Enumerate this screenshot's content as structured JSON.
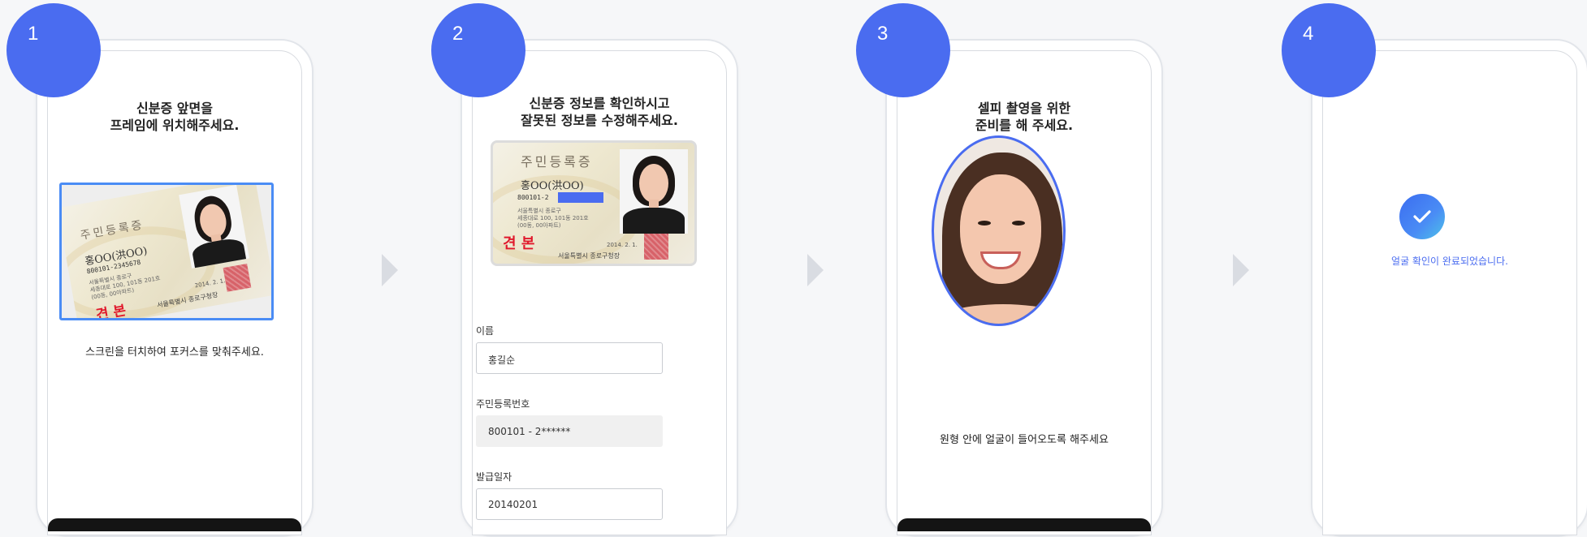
{
  "colors": {
    "accent": "#4a6cf0",
    "background": "#f6f7f9",
    "arrow": "#d9dce2",
    "card_sample_red": "#e0192c"
  },
  "steps": [
    {
      "number": "1",
      "title_line1": "신분증 앞면을",
      "title_line2": "프레임에 위치해주세요.",
      "hint": "스크린을 터치하여 포커스를 맞춰주세요.",
      "card": {
        "title": "주민등록증",
        "name": "홍OO(洪OO)",
        "number": "800101-2345678",
        "address_line1": "서울특별시 종로구",
        "address_line2": "세종대로 100, 101동 201호",
        "address_line3": "(00동, 00아파트)",
        "sample_mark": "견 본",
        "issue_date": "2014. 2. 1.",
        "authority": "서울특별시 종로구청장"
      }
    },
    {
      "number": "2",
      "title_line1": "신분증 정보를 확인하시고",
      "title_line2": "잘못된 정보를 수정해주세요.",
      "card": {
        "title": "주민등록증",
        "name": "홍OO(洪OO)",
        "number": "800101-2",
        "address_line1": "서울특별시 종로구",
        "address_line2": "세종대로 100, 101동 201호",
        "address_line3": "(00동, 00아파트)",
        "sample_mark": "견 본",
        "issue_date": "2014. 2. 1.",
        "authority": "서울특별시 종로구청장"
      },
      "fields": [
        {
          "label": "이름",
          "value": "홍길순"
        },
        {
          "label": "주민등록번호",
          "value": "800101 - 2******"
        },
        {
          "label": "발급일자",
          "value": "20140201"
        }
      ]
    },
    {
      "number": "3",
      "title_line1": "셀피 촬영을 위한",
      "title_line2": "준비를 해 주세요.",
      "hint": "원형 안에 얼굴이 들어오도록 해주세요"
    },
    {
      "number": "4",
      "message": "얼굴 확인이 완료되었습니다."
    }
  ]
}
